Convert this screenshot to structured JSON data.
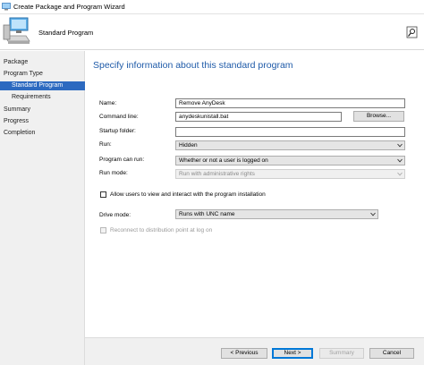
{
  "window": {
    "title": "Create Package and Program Wizard"
  },
  "header": {
    "title": "Standard Program"
  },
  "sidebar": {
    "items": [
      {
        "label": "Package"
      },
      {
        "label": "Program Type"
      },
      {
        "label": "Standard Program"
      },
      {
        "label": "Requirements"
      },
      {
        "label": "Summary"
      },
      {
        "label": "Progress"
      },
      {
        "label": "Completion"
      }
    ]
  },
  "main": {
    "title": "Specify information about this standard program",
    "name": {
      "label": "Name:",
      "value": "Remove AnyDesk"
    },
    "command_line": {
      "label": "Command line:",
      "value": "anydeskunistall.bat",
      "browse_label": "Browse..."
    },
    "startup_folder": {
      "label": "Startup folder:",
      "value": ""
    },
    "run": {
      "label": "Run:",
      "value": "Hidden"
    },
    "program_can_run": {
      "label": "Program can run:",
      "value": "Whether or not a user is logged on"
    },
    "run_mode": {
      "label": "Run mode:",
      "value": "Run with administrative rights"
    },
    "allow_users": {
      "label": "Allow users to view and interact with the program installation",
      "checked": false
    },
    "drive_mode": {
      "label": "Drive mode:",
      "value": "Runs with UNC name"
    },
    "reconnect": {
      "label": "Reconnect to distribution point at log on",
      "checked": false
    }
  },
  "footer": {
    "previous_label": "< Previous",
    "next_label": "Next >",
    "summary_label": "Summary",
    "cancel_label": "Cancel"
  },
  "colors": {
    "accent": "#1e5aa8",
    "selection": "#2d6ac0",
    "sidebar_bg": "#f0f0f0"
  },
  "icons": [
    "wizard-computer-icon",
    "search-user-icon",
    "chevron-down-icon",
    "app-icon"
  ]
}
